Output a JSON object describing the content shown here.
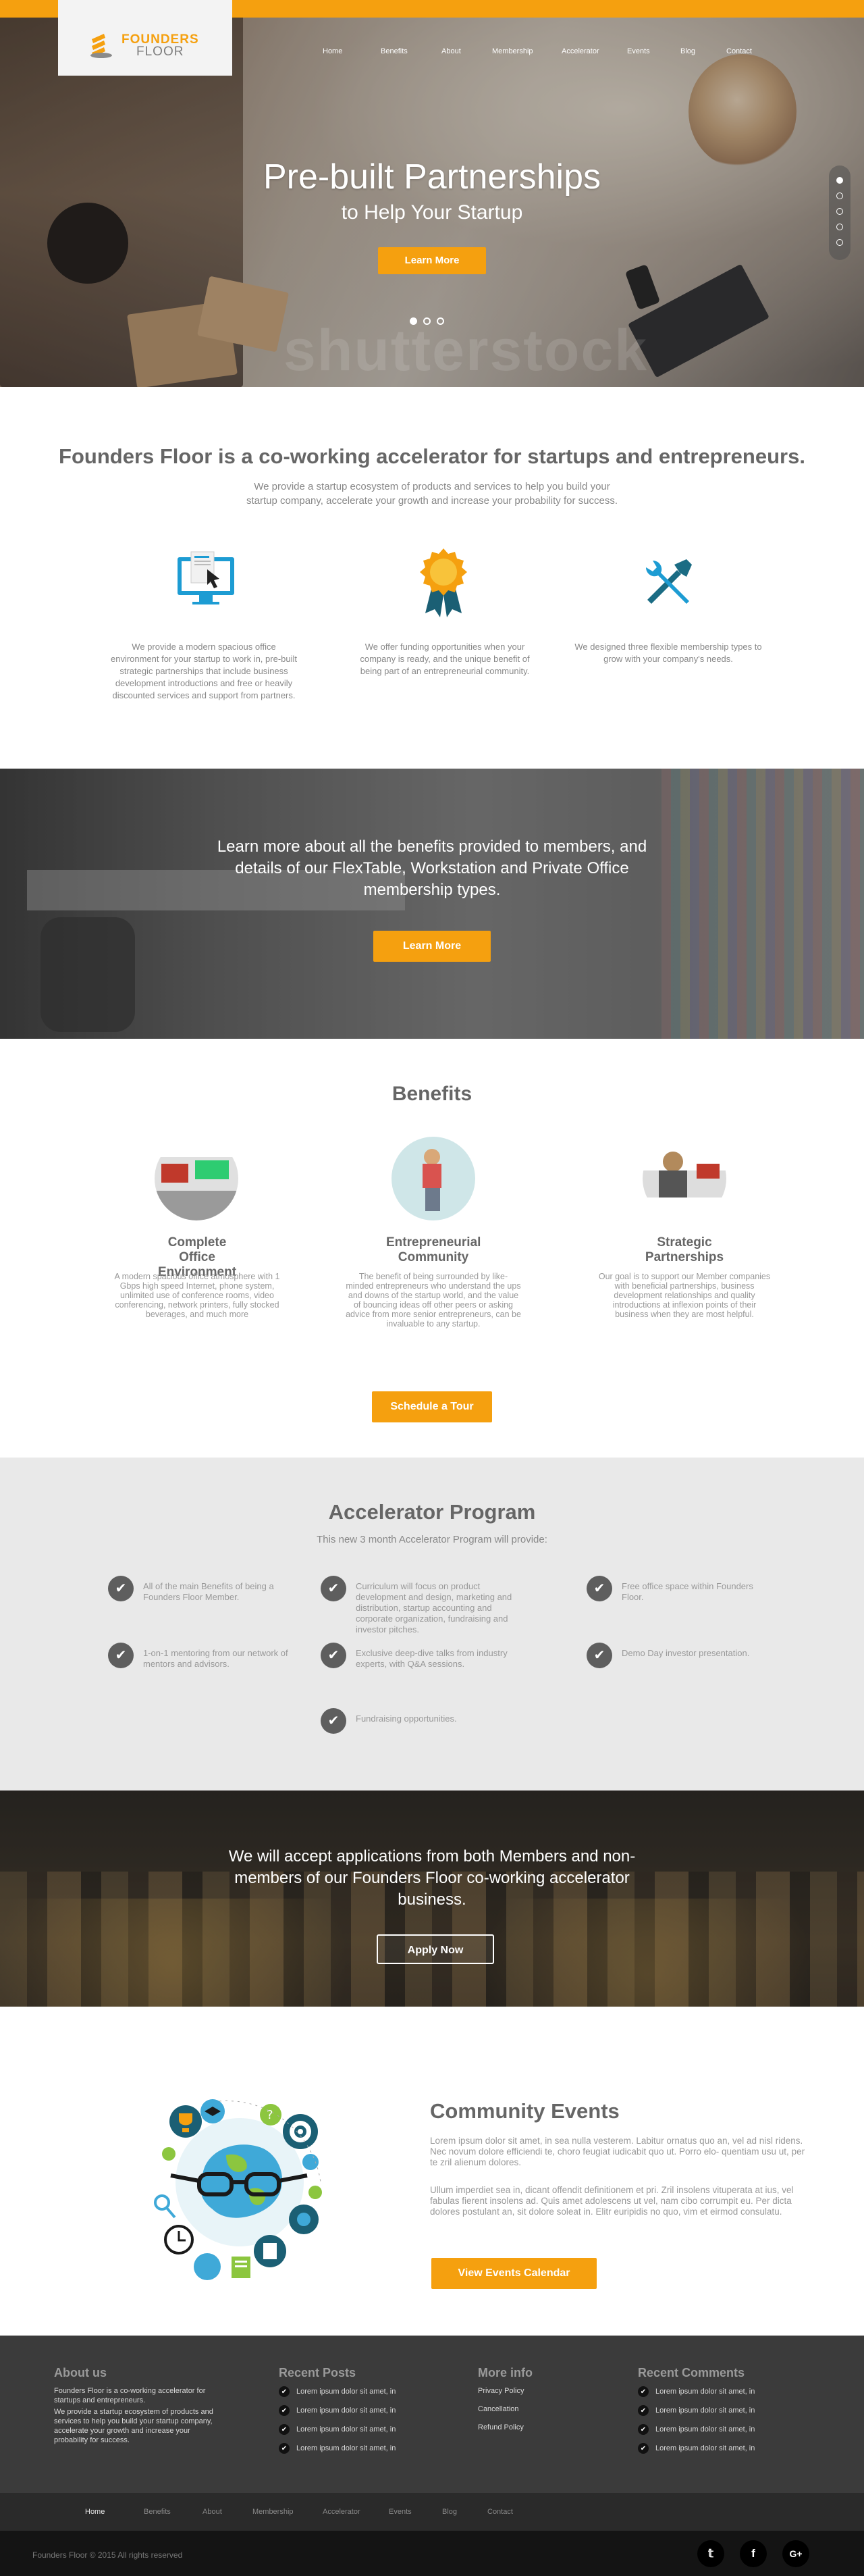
{
  "brand": {
    "name_line1": "FOUNDERS",
    "name_line2": "FLOOR",
    "accent": "#f5a00f"
  },
  "nav": [
    "Home",
    "Benefits",
    "About",
    "Membership",
    "Accelerator",
    "Events",
    "Blog",
    "Contact"
  ],
  "hero": {
    "title": "Pre-built Partnerships",
    "subtitle": "to Help Your Startup",
    "button": "Learn More",
    "watermark": "shutterstock"
  },
  "intro": {
    "title": "Founders Floor is a co-working accelerator for startups and entrepreneurs.",
    "subtitle_line1": "We provide a startup ecosystem of products and services to help you build your",
    "subtitle_line2": "startup company, accelerate your growth and increase your probability for success.",
    "features": [
      {
        "icon": "monitor-cursor-icon",
        "text": "We provide a modern spacious office environment for your startup to work in, pre-built strategic partnerships that include business development introductions and free or heavily discounted services and support from partners."
      },
      {
        "icon": "award-medal-icon",
        "text": "We offer funding opportunities when your company is ready, and the unique benefit of being part of an entrepreneurial community."
      },
      {
        "icon": "wrench-screwdriver-icon",
        "text": "We designed three flexible membership types to grow with your company's needs."
      }
    ]
  },
  "banner1": {
    "text": "Learn more about all the benefits provided to members, and details of our FlexTable, Workstation and Private Office membership types.",
    "button": "Learn More"
  },
  "benefits": {
    "title": "Benefits",
    "items": [
      {
        "title": "Complete Office Environment",
        "text": "A modern spacious office atmosphere with 1 Gbps high speed Internet, phone system, unlimited use of conference rooms, video conferencing, network printers, fully stocked beverages, and much more"
      },
      {
        "title": "Entrepreneurial Community",
        "text": "The benefit of being surrounded by like-minded entrepreneurs who understand the ups and downs of the startup world, and the value of bouncing ideas off other peers or asking advice from more senior entrepreneurs, can be invaluable to any startup."
      },
      {
        "title": "Strategic Partnerships",
        "text": "Our goal is to support our Member companies with beneficial partnerships, business development relationships and quality introductions at inflexion points of their business when they are most helpful."
      }
    ],
    "button": "Schedule a Tour"
  },
  "accelerator": {
    "title": "Accelerator Program",
    "subtitle": "This new 3 month Accelerator Program will provide:",
    "items": [
      "All of the main Benefits of being a Founders Floor Member.",
      "Curriculum will focus on product development and design, marketing and distribution, startup accounting and corporate organization, fundraising and investor pitches.",
      "Free office space within Founders Floor.",
      "1-on-1 mentoring from our network of mentors and advisors.",
      "Exclusive deep-dive talks from industry experts, with Q&A sessions.",
      "Demo Day investor presentation.",
      "Fundraising opportunities."
    ]
  },
  "banner2": {
    "text": "We will accept applications from both Members and non-members of our Founders Floor co-working accelerator business.",
    "button": "Apply Now"
  },
  "events": {
    "title": "Community Events",
    "p1": "Lorem ipsum dolor sit amet, in sea nulla vesterem. Labitur ornatus quo an, vel ad nisl ridens. Nec novum dolore efficiendi te, choro feugiat iudicabit quo ut. Porro elo- quentiam usu ut, per te zril alienum dolores.",
    "p2": "Ullum imperdiet sea in, dicant offendit definitionem et pri. Zril insolens vituperata at ius, vel fabulas fierent insolens ad. Quis amet adolescens ut vel, nam cibo corrumpit eu. Per dicta dolores postulant an, sit dolore soleat in. Elitr euripidis no quo, vim et eirmod consulatu.",
    "button": "View Events Calendar"
  },
  "footer": {
    "about_title": "About us",
    "about_p1": "Founders Floor is a co-working accelerator for startups and entrepreneurs.",
    "about_p2": "We provide a startup ecosystem of products and services to help you build your startup company, accelerate your growth and increase your probability for success.",
    "posts_title": "Recent Posts",
    "posts": [
      "Lorem ipsum dolor sit amet, in",
      "Lorem ipsum dolor sit amet, in",
      "Lorem ipsum dolor sit amet, in",
      "Lorem ipsum dolor sit amet, in"
    ],
    "more_title": "More info",
    "more": [
      "Privacy Policy",
      "Cancellation",
      "Refund Policy"
    ],
    "comments_title": "Recent Comments",
    "comments": [
      "Lorem ipsum dolor sit amet, in",
      "Lorem ipsum dolor sit amet, in",
      "Lorem ipsum dolor sit amet, in",
      "Lorem ipsum dolor sit amet, in"
    ],
    "nav": [
      "Home",
      "Benefits",
      "About",
      "Membership",
      "Accelerator",
      "Events",
      "Blog",
      "Contact"
    ],
    "copyright": "Founders Floor © 2015 All rights reserved",
    "social": [
      {
        "icon": "twitter-icon",
        "glyph": "𝕥"
      },
      {
        "icon": "facebook-icon",
        "glyph": "f"
      },
      {
        "icon": "google-plus-icon",
        "glyph": "G+"
      }
    ]
  }
}
